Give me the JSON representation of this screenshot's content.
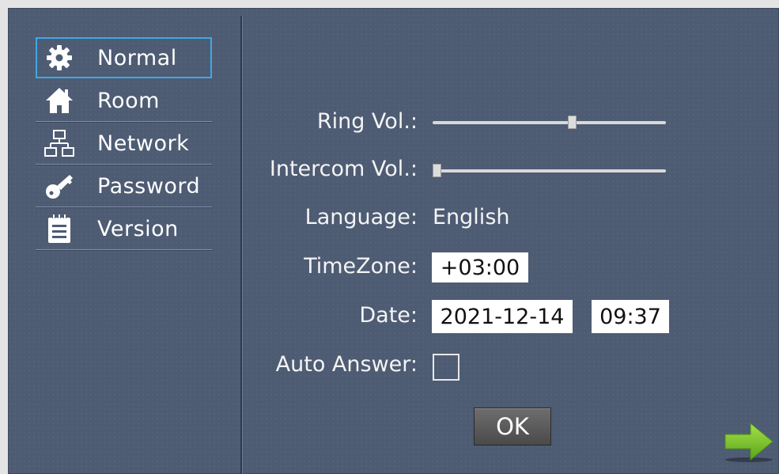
{
  "sidebar": {
    "items": [
      {
        "label": "Normal",
        "icon": "gear-icon",
        "active": true
      },
      {
        "label": "Room",
        "icon": "home-icon",
        "active": false
      },
      {
        "label": "Network",
        "icon": "network-icon",
        "active": false
      },
      {
        "label": "Password",
        "icon": "key-icon",
        "active": false
      },
      {
        "label": "Version",
        "icon": "notepad-icon",
        "active": false
      }
    ]
  },
  "settings": {
    "ring_vol_label": "Ring Vol.:",
    "ring_vol_value": 0.6,
    "intercom_vol_label": "Intercom Vol.:",
    "intercom_vol_value": 0.0,
    "language_label": "Language:",
    "language_value": "English",
    "timezone_label": "TimeZone:",
    "timezone_value": "+03:00",
    "date_label": "Date:",
    "date_value": "2021-12-14",
    "time_value": "09:37",
    "auto_answer_label": "Auto Answer:",
    "auto_answer_checked": false
  },
  "buttons": {
    "ok_label": "OK",
    "next_icon": "arrow-right-icon"
  },
  "colors": {
    "panel_bg": "#4d5b73",
    "active_outline": "#3fa7e6",
    "next_arrow": "#7ecb2e"
  }
}
